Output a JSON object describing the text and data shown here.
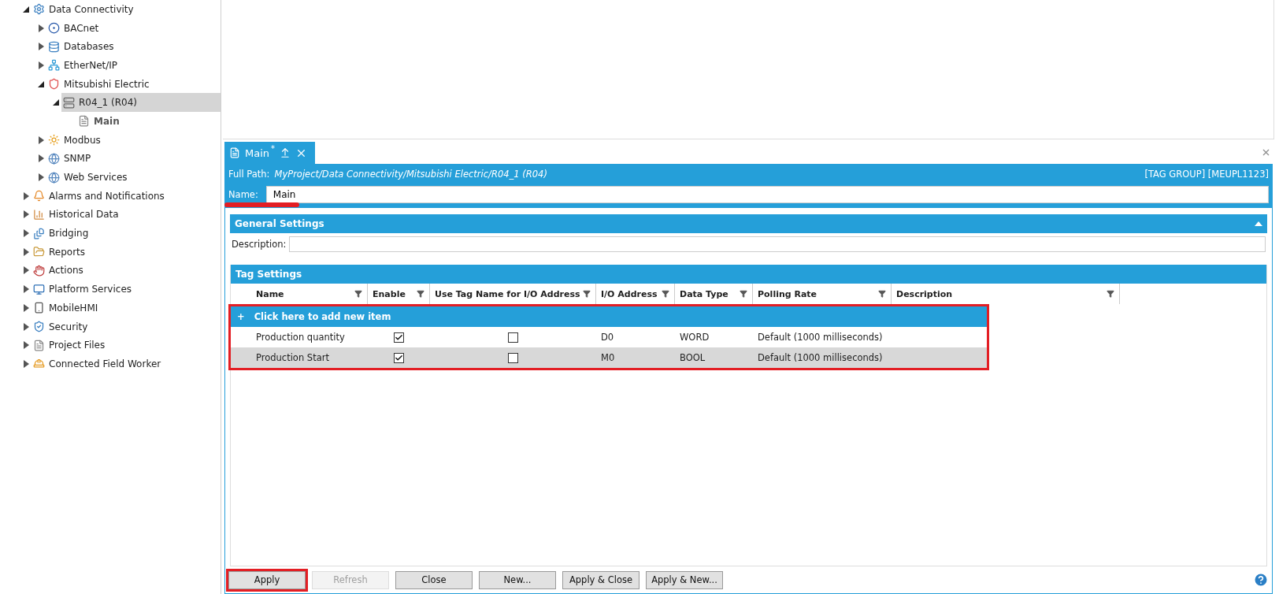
{
  "tree": [
    {
      "label": "Data Connectivity",
      "kind": "gears",
      "expanded": true,
      "selected": false,
      "children": [
        {
          "label": "BACnet",
          "kind": "ring",
          "expanded": false,
          "selected": false
        },
        {
          "label": "Databases",
          "kind": "database",
          "expanded": false,
          "selected": false
        },
        {
          "label": "EtherNet/IP",
          "kind": "network",
          "expanded": false,
          "selected": false
        },
        {
          "label": "Mitsubishi Electric",
          "kind": "shield",
          "expanded": true,
          "selected": false,
          "children": [
            {
              "label": "R04_1 (R04)",
              "kind": "device",
              "expanded": true,
              "selected": true,
              "children": [
                {
                  "label": "Main",
                  "kind": "file",
                  "selected": false,
                  "bold": true
                }
              ]
            }
          ]
        },
        {
          "label": "Modbus",
          "kind": "sun",
          "expanded": false,
          "selected": false
        },
        {
          "label": "SNMP",
          "kind": "globe",
          "expanded": false,
          "selected": false
        },
        {
          "label": "Web Services",
          "kind": "globe",
          "expanded": false,
          "selected": false
        }
      ]
    },
    {
      "label": "Alarms and Notifications",
      "kind": "bell",
      "expanded": false,
      "selected": false
    },
    {
      "label": "Historical Data",
      "kind": "chart",
      "expanded": false,
      "selected": false
    },
    {
      "label": "Bridging",
      "kind": "doc",
      "expanded": false,
      "selected": false
    },
    {
      "label": "Reports",
      "kind": "folder",
      "expanded": false,
      "selected": false
    },
    {
      "label": "Actions",
      "kind": "hand",
      "expanded": false,
      "selected": false
    },
    {
      "label": "Platform Services",
      "kind": "monitor",
      "expanded": false,
      "selected": false
    },
    {
      "label": "MobileHMI",
      "kind": "phone",
      "expanded": false,
      "selected": false
    },
    {
      "label": "Security",
      "kind": "security",
      "expanded": false,
      "selected": false
    },
    {
      "label": "Project Files",
      "kind": "file",
      "expanded": false,
      "selected": false
    },
    {
      "label": "Connected Field Worker",
      "kind": "worker",
      "expanded": false,
      "selected": false
    }
  ],
  "tab": {
    "label": "Main",
    "modified_mark": "*",
    "selected": true
  },
  "header": {
    "path_label": "Full Path:",
    "path": "MyProject/Data Connectivity/Mitsubishi Electric/R04_1 (R04)",
    "info": "[TAG GROUP] [MEUPL1123]",
    "name_label": "Name:",
    "name_value": "Main",
    "name_highlighted": true
  },
  "general": {
    "title": "General Settings",
    "expanded": true,
    "description_label": "Description:"
  },
  "tag_settings": {
    "title": "Tag Settings",
    "columns": [
      "Name",
      "Enable",
      "Use Tag Name for I/O Address",
      "I/O Address",
      "Data Type",
      "Polling Rate",
      "Description"
    ],
    "add_row": {
      "icon": "+",
      "label": "Click here to add new item"
    },
    "rows_highlighted": true,
    "rows": [
      {
        "name": "Production quantity",
        "enable": true,
        "use_tag_name": false,
        "io_address": "D0",
        "data_type": "WORD",
        "polling_rate": "Default (1000 milliseconds)",
        "selected": false
      },
      {
        "name": "Production Start",
        "enable": true,
        "use_tag_name": false,
        "io_address": "M0",
        "data_type": "BOOL",
        "polling_rate": "Default (1000 milliseconds)",
        "selected": true
      }
    ]
  },
  "buttons": [
    {
      "label": "Apply",
      "disabled": false,
      "highlighted": true
    },
    {
      "label": "Refresh",
      "disabled": true,
      "highlighted": false
    },
    {
      "label": "Close",
      "disabled": false,
      "highlighted": false
    },
    {
      "label": "New...",
      "disabled": false,
      "highlighted": false
    },
    {
      "label": "Apply & Close",
      "disabled": false,
      "highlighted": false
    },
    {
      "label": "Apply & New...",
      "disabled": false,
      "highlighted": false
    }
  ]
}
